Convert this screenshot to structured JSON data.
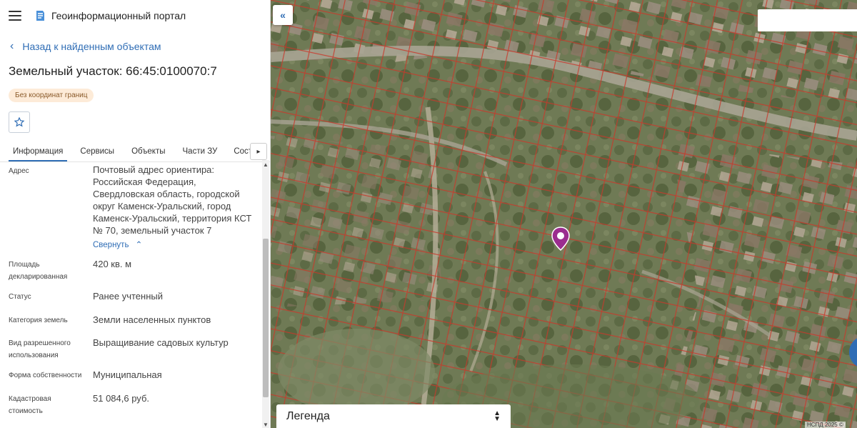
{
  "app": {
    "title": "Геоинформационный портал"
  },
  "nav": {
    "back_label": "Назад к найденным объектам"
  },
  "object": {
    "title": "Земельный участок: 66:45:0100070:7",
    "badge": "Без координат границ"
  },
  "tabs": [
    {
      "label": "Информация",
      "active": true
    },
    {
      "label": "Сервисы",
      "active": false
    },
    {
      "label": "Объекты",
      "active": false
    },
    {
      "label": "Части ЗУ",
      "active": false
    },
    {
      "label": "Состав",
      "active": false
    }
  ],
  "info": {
    "address": {
      "label": "Адрес",
      "value": "Почтовый адрес ориентира: Российская Федерация, Свердловская область, городской округ Каменск-Уральский, город Каменск-Уральский, территория КСТ № 70, земельный участок 7",
      "collapse_label": "Свернуть"
    },
    "area": {
      "label": "Площадь декларированная",
      "value": "420 кв. м"
    },
    "status": {
      "label": "Статус",
      "value": "Ранее учтенный"
    },
    "category": {
      "label": "Категория земель",
      "value": "Земли населенных пунктов"
    },
    "permitted_use": {
      "label": "Вид разрешенного использования",
      "value": "Выращивание садовых культур"
    },
    "ownership": {
      "label": "Форма собственности",
      "value": "Муниципальная"
    },
    "cadastral_value": {
      "label": "Кадастровая стоимость",
      "value": "51 084,6 руб."
    }
  },
  "map": {
    "legend_label": "Легенда",
    "copyright": "НСПД 2025 ©"
  },
  "colors": {
    "accent": "#2f6db5",
    "pin": "#9b2d8f",
    "parcel_line": "#c8392b",
    "badge_bg": "#fdebd8"
  },
  "icons": [
    "hamburger-icon",
    "portal-logo-icon",
    "chevron-left-icon",
    "star-icon",
    "chevron-right-icon",
    "chevron-up-icon",
    "double-chevron-left-icon",
    "map-pin-icon",
    "sort-arrows-icon"
  ]
}
